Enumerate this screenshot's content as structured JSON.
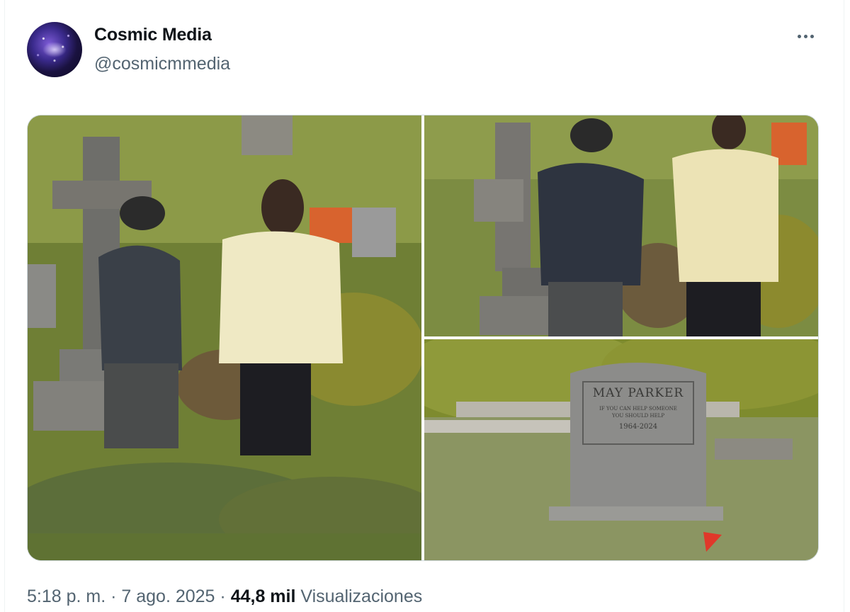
{
  "author": {
    "name": "Cosmic Media",
    "handle": "@cosmicmmedia",
    "avatar_icon": "galaxy-avatar"
  },
  "more_icon": "ellipsis-icon",
  "media": {
    "headstone": {
      "name": "MAY PARKER",
      "line1": "IF YOU CAN HELP SOMEONE",
      "line2": "YOU SHOULD HELP",
      "dates": "1964-2024"
    }
  },
  "meta": {
    "time": "5:18 p. m.",
    "separator1": " · ",
    "date": "7 ago. 2025",
    "separator2": " · ",
    "views_count": "44,8 mil",
    "views_label": " Visualizaciones"
  },
  "colors": {
    "text_primary": "#0f1419",
    "text_secondary": "#536471",
    "border": "#cfd9de"
  }
}
